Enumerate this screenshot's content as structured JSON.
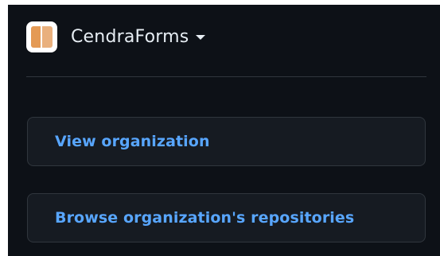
{
  "org": {
    "name": "CendraForms"
  },
  "actions": [
    {
      "label": "View organization"
    },
    {
      "label": "Browse organization's repositories"
    }
  ],
  "colors": {
    "background": "#0d1117",
    "card": "#161b22",
    "border": "#30363d",
    "link": "#58a6ff",
    "text": "#e6edf3",
    "avatar_left": "#e49a55",
    "avatar_right": "#e9b07d"
  },
  "icons": {
    "org_avatar": "org-avatar-icon",
    "dropdown": "caret-down-icon"
  }
}
